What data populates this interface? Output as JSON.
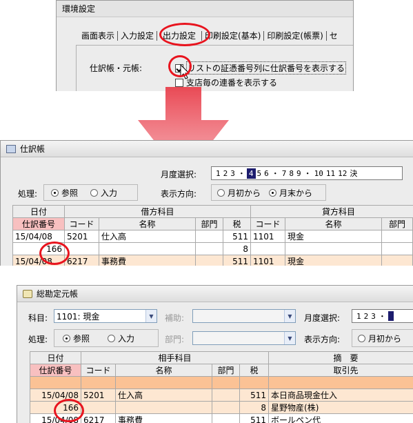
{
  "settings_dialog": {
    "title": "環境設定",
    "tabs": [
      "画面表示",
      "入力設定",
      "出力設定",
      "印刷設定(基本)",
      "印刷設定(帳票)",
      "セ"
    ],
    "row_label": "仕訳帳・元帳:",
    "options": [
      {
        "label": "リストの証憑番号列に仕訳番号を表示する",
        "checked": true
      },
      {
        "label": "支店毎の連番を表示する",
        "checked": false
      }
    ]
  },
  "journal_window": {
    "title": "仕訳帳",
    "month_label": "月度選択:",
    "months": [
      "1",
      "2",
      "3",
      "・",
      "4",
      "5",
      "6",
      "・",
      "7",
      "8",
      "9",
      "・",
      "10",
      "11",
      "12",
      "決"
    ],
    "selected_month": "4",
    "mode_label": "処理:",
    "mode_options": [
      "参照",
      "入力"
    ],
    "mode_selected": "参照",
    "direction_label": "表示方向:",
    "direction_options": [
      "月初から",
      "月末から"
    ],
    "direction_selected": "月末から",
    "header_row1": {
      "date": "日付",
      "debit": "借方科目",
      "credit": "貸方科目"
    },
    "header_row2": {
      "entry_no": "仕訳番号",
      "code": "コード",
      "name": "名称",
      "dept": "部門",
      "tax": "税",
      "code2": "コード",
      "name2": "名称",
      "dept2": "部門"
    },
    "rows": [
      {
        "date": "15/04/08",
        "code": "5201",
        "name": "仕入高",
        "dept": "",
        "tax": "511",
        "code2": "1101",
        "name2": "現金",
        "dept2": ""
      },
      {
        "date": "166",
        "code": "",
        "name": "",
        "dept": "",
        "tax": "8",
        "code2": "",
        "name2": "",
        "dept2": ""
      },
      {
        "date": "15/04/08",
        "code": "6217",
        "name": "事務費",
        "dept": "",
        "tax": "511",
        "code2": "1101",
        "name2": "現金",
        "dept2": ""
      }
    ]
  },
  "ledger_window": {
    "title": "総勘定元帳",
    "account_label": "科目:",
    "account_value": "1101: 現金",
    "sub_label": "補助:",
    "sub_value": "",
    "month_label": "月度選択:",
    "months": [
      "1",
      "2",
      "3",
      "・"
    ],
    "mode_label": "処理:",
    "mode_options": [
      "参照",
      "入力"
    ],
    "mode_selected": "参照",
    "dept_label": "部門:",
    "dept_value": "",
    "direction_label": "表示方向:",
    "direction_option": "月初から",
    "header_row1": {
      "date": "日付",
      "counter": "相手科目",
      "summary": "摘　要"
    },
    "header_row2": {
      "entry_no": "仕訳番号",
      "code": "コード",
      "name": "名称",
      "dept": "部門",
      "tax": "税",
      "client": "取引先"
    },
    "rows": [
      {
        "date": "15/04/08",
        "code": "5201",
        "name": "仕入高",
        "dept": "",
        "tax": "511",
        "summary": "本日商品現金仕入"
      },
      {
        "date": "166",
        "code": "",
        "name": "",
        "dept": "",
        "tax": "8",
        "summary": "星野物産(株)"
      },
      {
        "date": "15/04/08",
        "code": "6217",
        "name": "事務費",
        "dept": "",
        "tax": "511",
        "summary": "ボールペン代"
      }
    ]
  },
  "colors": {
    "highlight": "#e8141e",
    "arrow": "#f07a82",
    "row_orange": "#fde7d2",
    "header_pink": "#f8c0c0",
    "month_selected": "#1d1d6e"
  }
}
